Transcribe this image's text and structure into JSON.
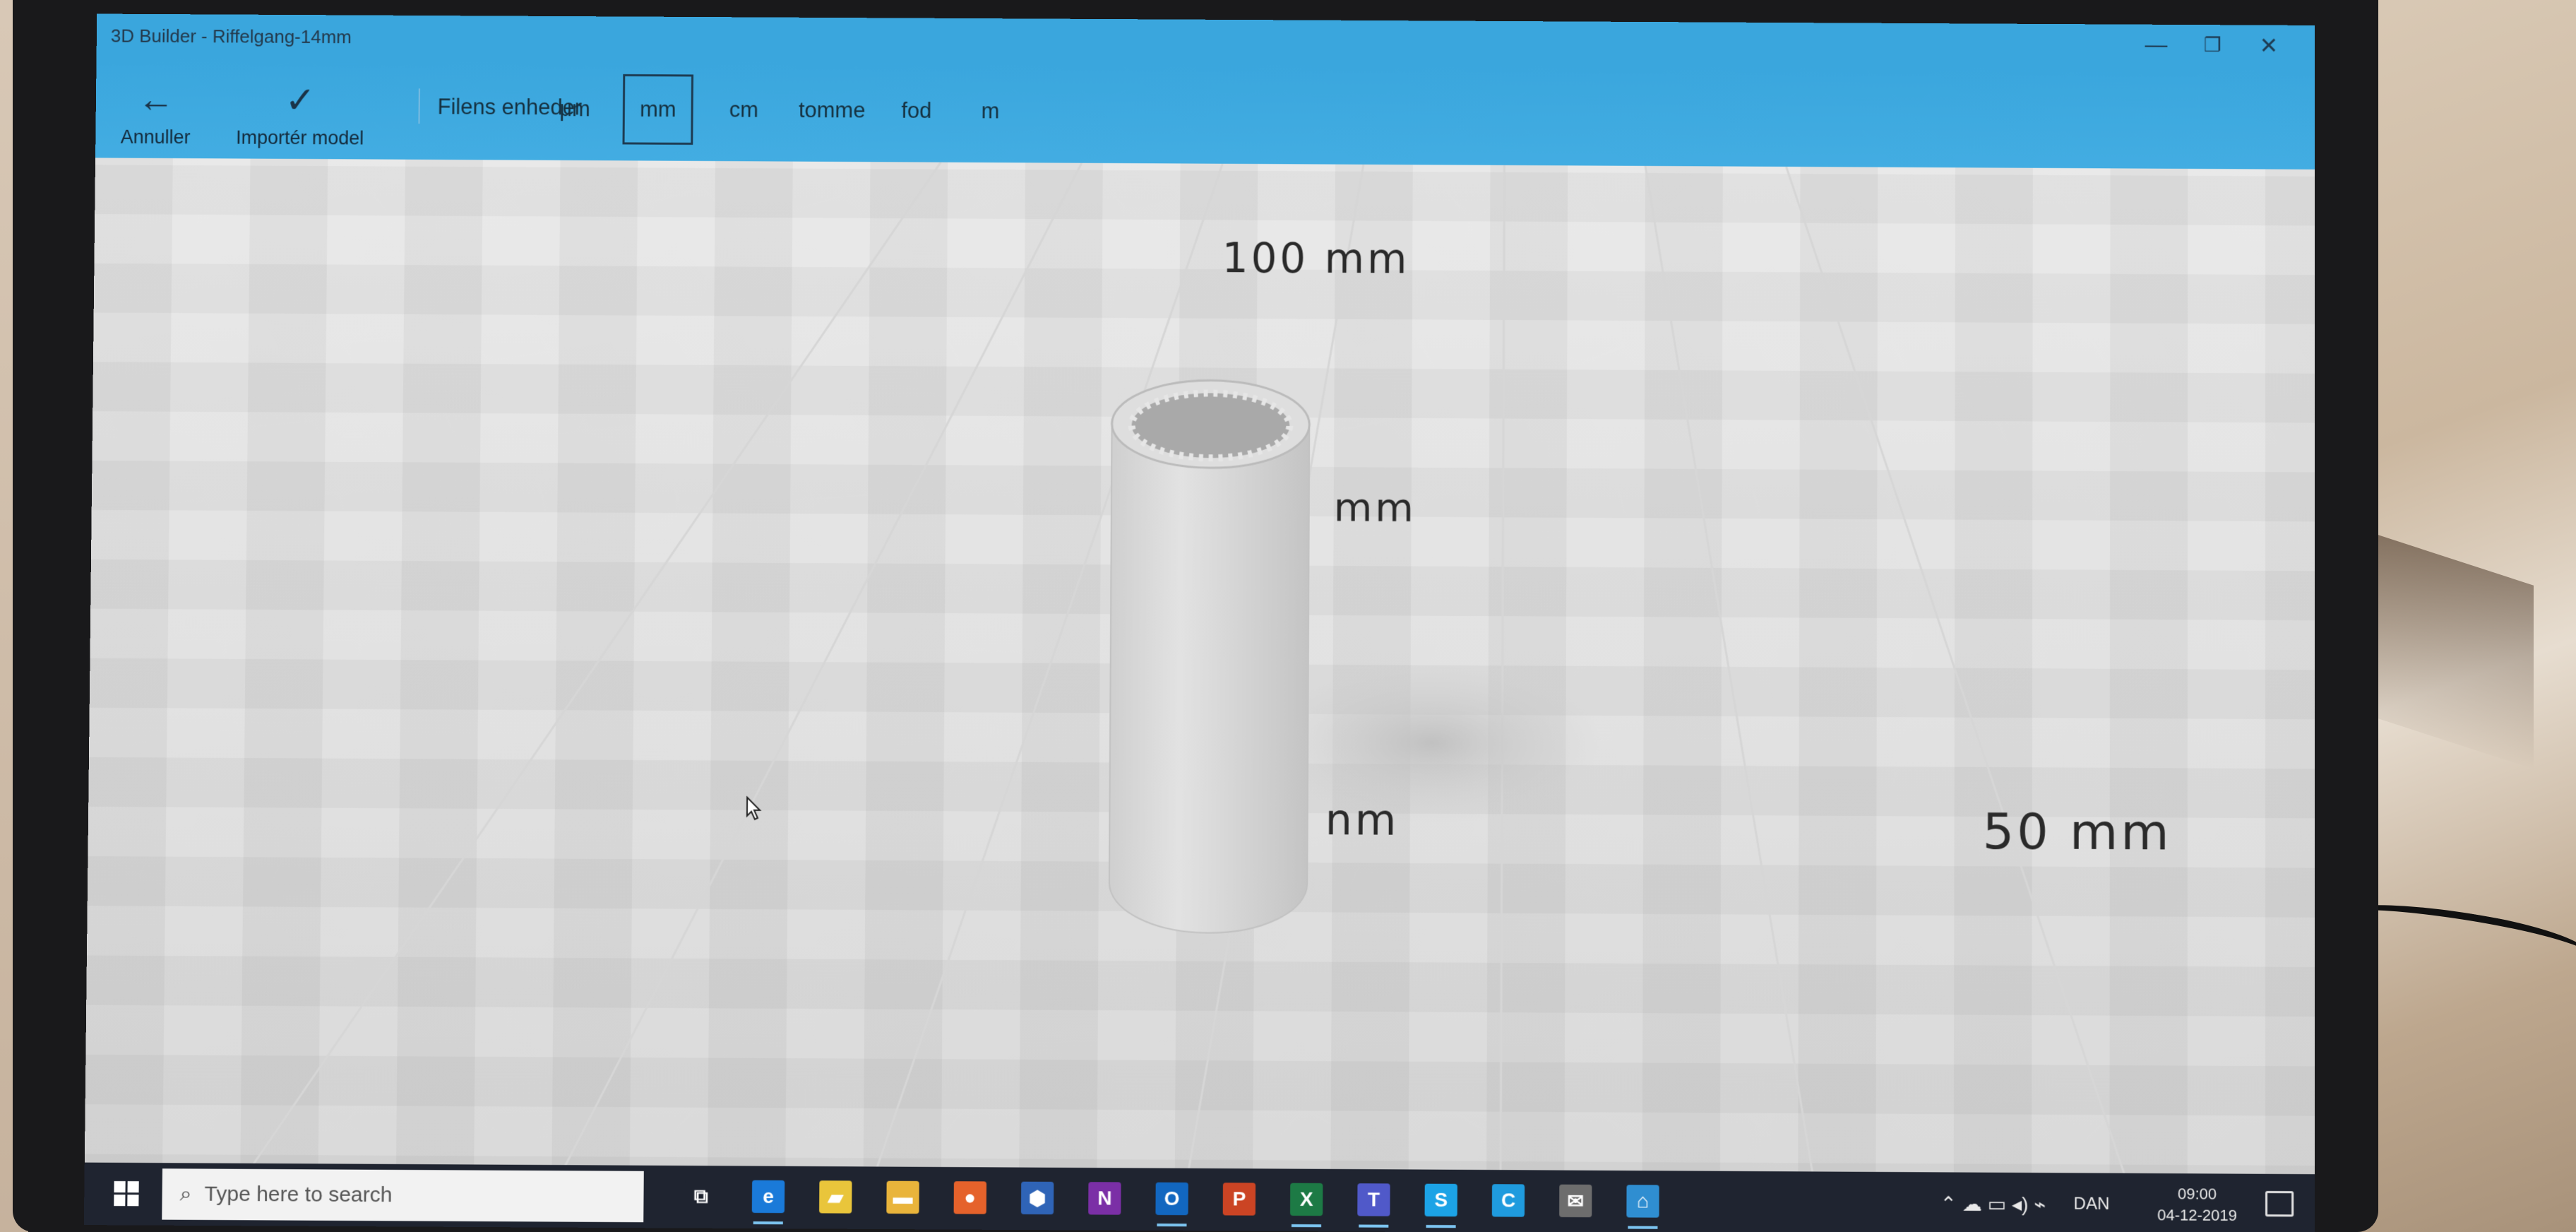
{
  "window": {
    "title": "3D Builder - Riffelgang-14mm",
    "controls": {
      "minimize": "—",
      "maximize": "❐",
      "close": "✕"
    }
  },
  "commandbar": {
    "back_label": "Annuller",
    "import_label": "Importér model",
    "units_label": "Filens enheder",
    "units": [
      {
        "label": "μm",
        "selected": false
      },
      {
        "label": "mm",
        "selected": true
      },
      {
        "label": "cm",
        "selected": false
      },
      {
        "label": "tomme",
        "selected": false
      },
      {
        "label": "fod",
        "selected": false
      },
      {
        "label": "m",
        "selected": false
      }
    ]
  },
  "viewport": {
    "dimension_labels": {
      "top": "100 mm",
      "middle": "mm",
      "lower": "nm",
      "right": "50 mm"
    },
    "model": "cylinder-with-internal-ribs"
  },
  "taskbar": {
    "search_placeholder": "Type here to search",
    "pinned": [
      {
        "name": "task-view",
        "glyph": "⧉",
        "color": "#1f2430"
      },
      {
        "name": "edge",
        "glyph": "e",
        "color": "#1a7ad9"
      },
      {
        "name": "sticky-notes",
        "glyph": "▰",
        "color": "#e9c53b"
      },
      {
        "name": "file-explorer",
        "glyph": "▬",
        "color": "#e9b43b"
      },
      {
        "name": "firefox",
        "glyph": "●",
        "color": "#e5622b"
      },
      {
        "name": "teams-shortcut",
        "glyph": "⬢",
        "color": "#2f64b7"
      },
      {
        "name": "onenote",
        "glyph": "N",
        "color": "#7b2fa6"
      },
      {
        "name": "outlook",
        "glyph": "O",
        "color": "#1267c0"
      },
      {
        "name": "powerpoint",
        "glyph": "P",
        "color": "#cb4424"
      },
      {
        "name": "excel",
        "glyph": "X",
        "color": "#1d7a45"
      },
      {
        "name": "teams",
        "glyph": "T",
        "color": "#5059c9"
      },
      {
        "name": "skype",
        "glyph": "S",
        "color": "#1ca3e6"
      },
      {
        "name": "cortana-app",
        "glyph": "C",
        "color": "#1f9bde"
      },
      {
        "name": "mail",
        "glyph": "✉",
        "color": "#6d6d6d"
      },
      {
        "name": "3d-builder",
        "glyph": "⌂",
        "color": "#2f8ed1"
      }
    ],
    "tray": {
      "icons": "⌃  ☁  ▭  ◂)  ⌁",
      "language": "DAN",
      "time": "09:00",
      "date": "04-12-2019"
    }
  },
  "colors": {
    "accent": "#3aa6dd",
    "taskbar": "#1f2430"
  }
}
